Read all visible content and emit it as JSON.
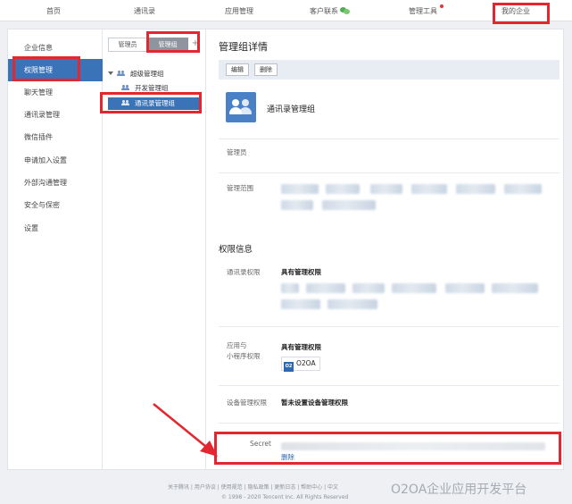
{
  "topnav": {
    "items": [
      "首页",
      "通讯录",
      "应用管理",
      "客户联系",
      "管理工具",
      "我的企业"
    ]
  },
  "sidebar": {
    "items": [
      "企业信息",
      "权限管理",
      "聊天管理",
      "通讯录管理",
      "微信插件",
      "申请加入设置",
      "外部沟通管理",
      "安全与保密",
      "设置"
    ],
    "active": "权限管理"
  },
  "middle": {
    "tabs": [
      "管理员",
      "管理组"
    ],
    "active_tab": "管理组",
    "add_label": "+",
    "tree": {
      "root": "超级管理组",
      "children": [
        "开发管理组",
        "通讯录管理组"
      ],
      "selected": "通讯录管理组"
    }
  },
  "detail": {
    "title": "管理组详情",
    "edit_label": "编辑",
    "delete_label": "删除",
    "group_name": "通讯录管理组",
    "admins_label": "管理员",
    "scope_label": "管理范围",
    "permissions_title": "权限信息",
    "contacts_perm_label": "通讯录权限",
    "contacts_perm_value": "具有管理权限",
    "app_perm_label_line1": "应用与",
    "app_perm_label_line2": "小程序权限",
    "app_perm_value": "具有管理权限",
    "app_chip_logo": "O2",
    "app_chip_name": "O2OA",
    "device_perm_label": "设备管理权限",
    "device_perm_value": "暂未设置设备管理权限",
    "secret_label": "Secret",
    "secret_delete_label": "删除"
  },
  "footer": {
    "links": "关于腾讯  |  用户协议  |  使用规范  |  隐私政策  |  更新日志  |  帮助中心  |  中文",
    "copyright": "© 1998 - 2020 Tencent Inc. All Rights Reserved"
  },
  "watermark": "O2OA企业应用开发平台",
  "colors": {
    "accent": "#3a73b8",
    "annotation_red": "#e3262f",
    "link_blue": "#2e68b2"
  },
  "icons": [
    "wechat-icon",
    "people-icon",
    "group-avatar-icon",
    "caret-down-icon",
    "app-logo-icon"
  ]
}
